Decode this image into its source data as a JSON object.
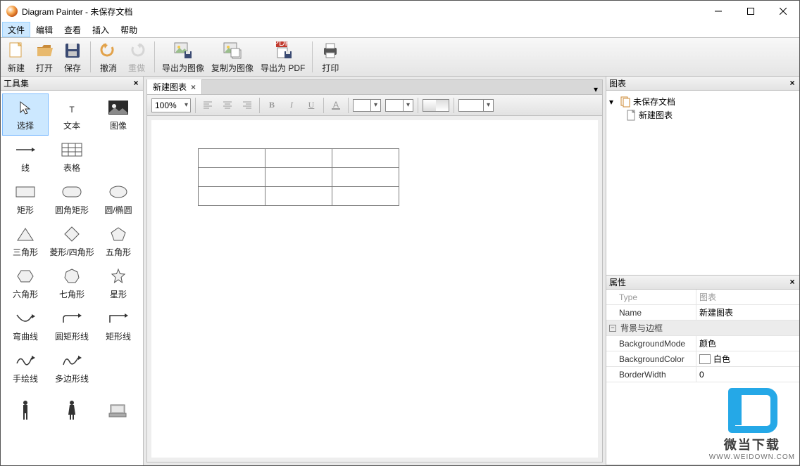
{
  "title": "Diagram Painter - 未保存文档",
  "menus": [
    "文件",
    "编辑",
    "查看",
    "插入",
    "帮助"
  ],
  "menu_active_index": 0,
  "toolbar": [
    {
      "id": "new",
      "label": "新建"
    },
    {
      "id": "open",
      "label": "打开"
    },
    {
      "id": "save",
      "label": "保存"
    },
    {
      "sep": true
    },
    {
      "id": "undo",
      "label": "撤消"
    },
    {
      "id": "redo",
      "label": "重做",
      "disabled": true
    },
    {
      "sep": true
    },
    {
      "id": "export-image",
      "label": "导出为图像"
    },
    {
      "id": "copy-image",
      "label": "复制为图像"
    },
    {
      "id": "export-pdf",
      "label": "导出为 PDF"
    },
    {
      "sep": true
    },
    {
      "id": "print",
      "label": "打印"
    }
  ],
  "left_pane_title": "工具集",
  "tools": [
    {
      "id": "select",
      "label": "选择",
      "selected": true
    },
    {
      "id": "text",
      "label": "文本"
    },
    {
      "id": "image",
      "label": "图像"
    },
    {
      "id": "line",
      "label": "线"
    },
    {
      "id": "table",
      "label": "表格"
    },
    {
      "id": "blank1",
      "label": ""
    },
    {
      "id": "rect",
      "label": "矩形"
    },
    {
      "id": "roundrect",
      "label": "圆角矩形"
    },
    {
      "id": "ellipse",
      "label": "圆/椭圆"
    },
    {
      "id": "triangle",
      "label": "三角形"
    },
    {
      "id": "diamond",
      "label": "菱形/四角形"
    },
    {
      "id": "pentagon",
      "label": "五角形"
    },
    {
      "id": "hexagon",
      "label": "六角形"
    },
    {
      "id": "heptagon",
      "label": "七角形"
    },
    {
      "id": "star",
      "label": "星形"
    },
    {
      "id": "curve",
      "label": "弯曲线"
    },
    {
      "id": "roundrectline",
      "label": "圆矩形线"
    },
    {
      "id": "rectline",
      "label": "矩形线"
    },
    {
      "id": "freehand",
      "label": "手绘线"
    },
    {
      "id": "polyline",
      "label": "多边形线"
    },
    {
      "id": "blank2",
      "label": ""
    },
    {
      "id": "person1",
      "label": ""
    },
    {
      "id": "person2",
      "label": ""
    },
    {
      "id": "server",
      "label": ""
    }
  ],
  "doc_tab": {
    "label": "新建图表"
  },
  "zoom": "100%",
  "tree_pane_title": "图表",
  "tree": {
    "root": "未保存文档",
    "child": "新建图表"
  },
  "prop_pane_title": "属性",
  "props": {
    "type_label": "Type",
    "type_value": "图表",
    "name_label": "Name",
    "name_value": "新建图表",
    "group_label": "背景与边框",
    "bgmode_label": "BackgroundMode",
    "bgmode_value": "颜色",
    "bgcolor_label": "BackgroundColor",
    "bgcolor_value": "白色",
    "border_label": "BorderWidth",
    "border_value": "0"
  },
  "watermark": {
    "line1": "微当下载",
    "line2": "WWW.WEIDOWN.COM"
  }
}
